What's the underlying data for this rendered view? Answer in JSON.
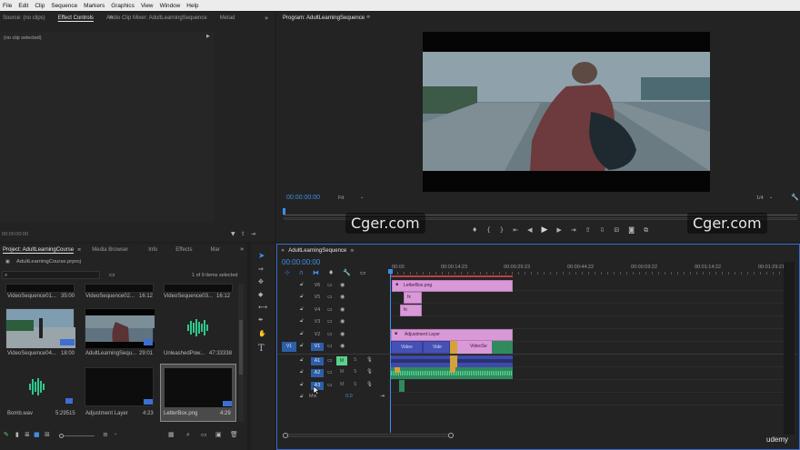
{
  "menu": [
    "File",
    "Edit",
    "Clip",
    "Sequence",
    "Markers",
    "Graphics",
    "View",
    "Window",
    "Help"
  ],
  "source_panel": {
    "tabs": [
      "Source: (no clips)",
      "Effect Controls",
      "Audio Clip Mixer: AdultLearningSequence",
      "Metad"
    ],
    "active_tab": "Effect Controls",
    "no_clip_text": "(no clip selected)",
    "timecode": "00:00:00:00"
  },
  "program_monitor": {
    "title": "Program: AdultLearningSequence",
    "timecode": "00:00:00:00",
    "fit": "Fit",
    "resolution": "1/4"
  },
  "watermarks": [
    "Cger.com",
    "Cger.com"
  ],
  "project_panel": {
    "tabs": [
      "Project: AdultLearningCourse",
      "Media Browser",
      "Info",
      "Effects",
      "Mar"
    ],
    "project_file": "AdultLearningCourse.prproj",
    "items_selected": "1 of 9 items selected",
    "top_row": [
      {
        "name": "VideoSequence01...",
        "duration": "35:00"
      },
      {
        "name": "VideoSequence02...",
        "duration": "16:12"
      },
      {
        "name": "VideoSequence03...",
        "duration": "16:12"
      }
    ],
    "mid_row": [
      {
        "name": "VideoSequence04...",
        "duration": "18:00"
      },
      {
        "name": "AdultLearningSequ...",
        "duration": "29:01"
      },
      {
        "name": "UnleashedPow...",
        "duration": "47:33338"
      }
    ],
    "bottom_row": [
      {
        "name": "Bomb.wav",
        "duration": "5:29515"
      },
      {
        "name": "Adjustment Layer",
        "duration": "4:23"
      },
      {
        "name": "LetterBox.png",
        "duration": "4:29"
      }
    ]
  },
  "timeline": {
    "tab": "AdultLearningSequence",
    "timecode": "00:00:00:00",
    "ruler": [
      "00:00",
      "00:00:14:23",
      "00:00:29:23",
      "00:00:44:22",
      "00:00:59:22",
      "00:01:14:22",
      "00:01:29:21"
    ],
    "video_tracks": [
      "V6",
      "V5",
      "V4",
      "V3",
      "V2",
      "V1"
    ],
    "audio_tracks": [
      "A1",
      "A2",
      "A3"
    ],
    "source_patch_video": "V1",
    "mix_label": "Mix",
    "mix_value": "0.0",
    "clips": {
      "letterbox": "LetterBox.png",
      "fx1": "fx",
      "fx2": "fx",
      "adjustment": "Adjustment Layer",
      "v1a": "Video",
      "v1b": "Vide",
      "v1c": "VideoSe"
    },
    "mute_label": "M",
    "solo_label": "S"
  },
  "branding": "udemy"
}
